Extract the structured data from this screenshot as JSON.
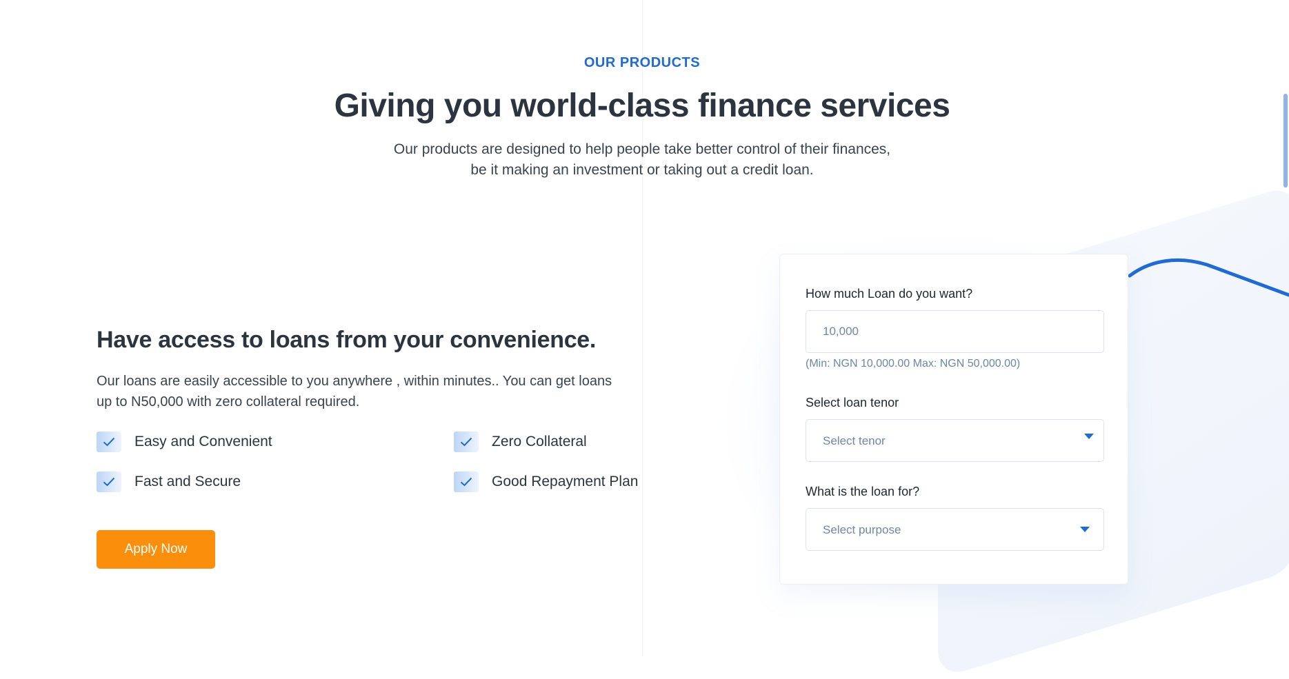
{
  "section": {
    "eyebrow": "OUR PRODUCTS",
    "title": "Giving you world-class finance services",
    "subtitle_line1": "Our products are designed to help people take better control of their finances,",
    "subtitle_line2": "be it making an investment or taking out a credit loan."
  },
  "loan": {
    "title": "Have access to loans from your convenience.",
    "desc_line1": "Our loans are easily accessible to you anywhere , within minutes.. You can get loans",
    "desc_line2": "up to N50,000 with zero collateral required.",
    "features": [
      {
        "label": "Easy and Convenient",
        "icon": "check-icon"
      },
      {
        "label": "Zero Collateral",
        "icon": "check-icon"
      },
      {
        "label": "Fast and Secure",
        "icon": "check-icon"
      },
      {
        "label": "Good Repayment Plan",
        "icon": "check-icon"
      }
    ],
    "apply_label": "Apply Now"
  },
  "form": {
    "amount_label": "How much Loan do you want?",
    "amount_placeholder": "10,000",
    "amount_hint": "(Min: NGN 10,000.00 Max: NGN 50,000.00)",
    "tenor_label": "Select loan tenor",
    "tenor_selected": "Select tenor",
    "purpose_label": "What is the loan for?",
    "purpose_selected": "Select purpose",
    "caret_icon": "caret-down-icon"
  },
  "colors": {
    "accent_blue": "#1d6ad8",
    "button_orange": "#fb8e0b",
    "heading": "#2c3440",
    "muted_text": "#6f86a6"
  }
}
